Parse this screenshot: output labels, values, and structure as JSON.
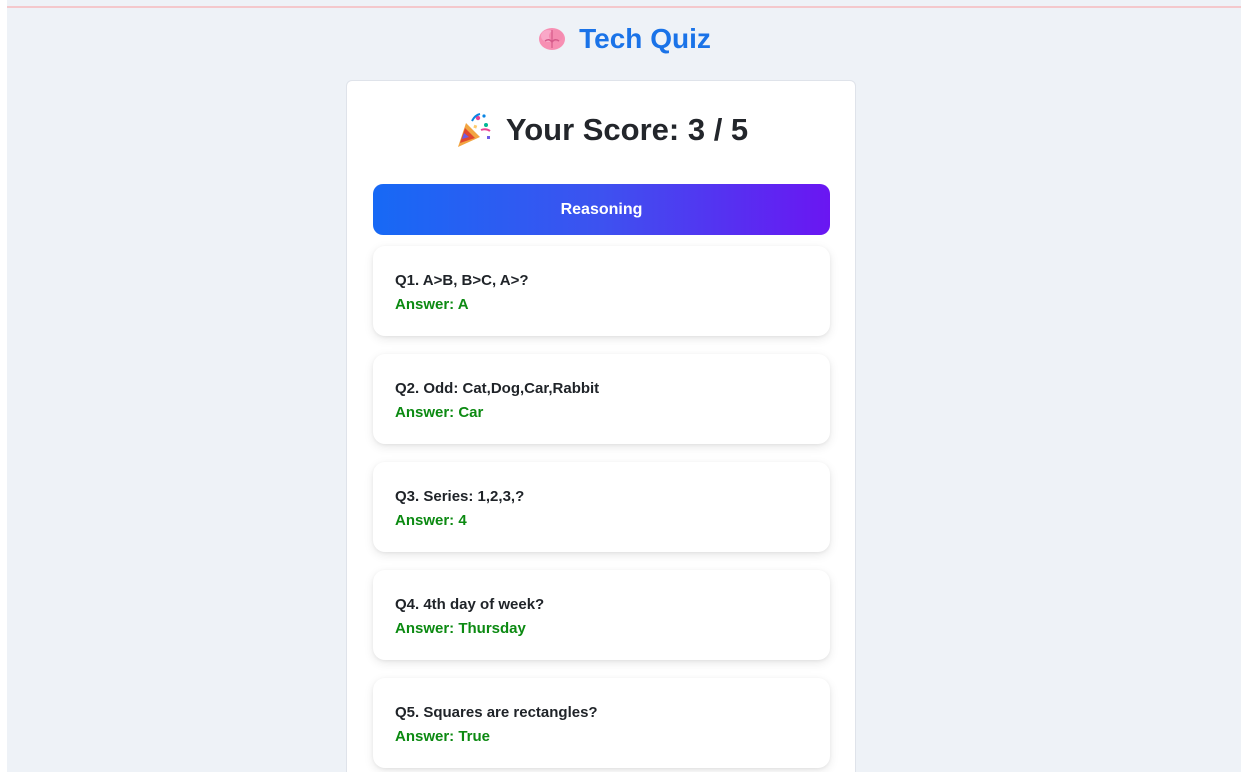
{
  "header": {
    "title": "Tech Quiz",
    "icon": "brain-icon"
  },
  "score": {
    "label": "Your Score: 3 / 5",
    "icon": "party-popper-icon"
  },
  "category": {
    "label": "Reasoning"
  },
  "questions": [
    {
      "question": "Q1. A>B, B>C, A>?",
      "answer": "Answer: A"
    },
    {
      "question": "Q2. Odd: Cat,Dog,Car,Rabbit",
      "answer": "Answer: Car"
    },
    {
      "question": "Q3. Series: 1,2,3,?",
      "answer": "Answer: 4"
    },
    {
      "question": "Q4. 4th day of week?",
      "answer": "Answer: Thursday"
    },
    {
      "question": "Q5. Squares are rectangles?",
      "answer": "Answer: True"
    }
  ],
  "colors": {
    "accent": "#1a73e8",
    "answer": "#0c8a12",
    "gradient_start": "#1769f5",
    "gradient_end": "#6a16f2"
  }
}
